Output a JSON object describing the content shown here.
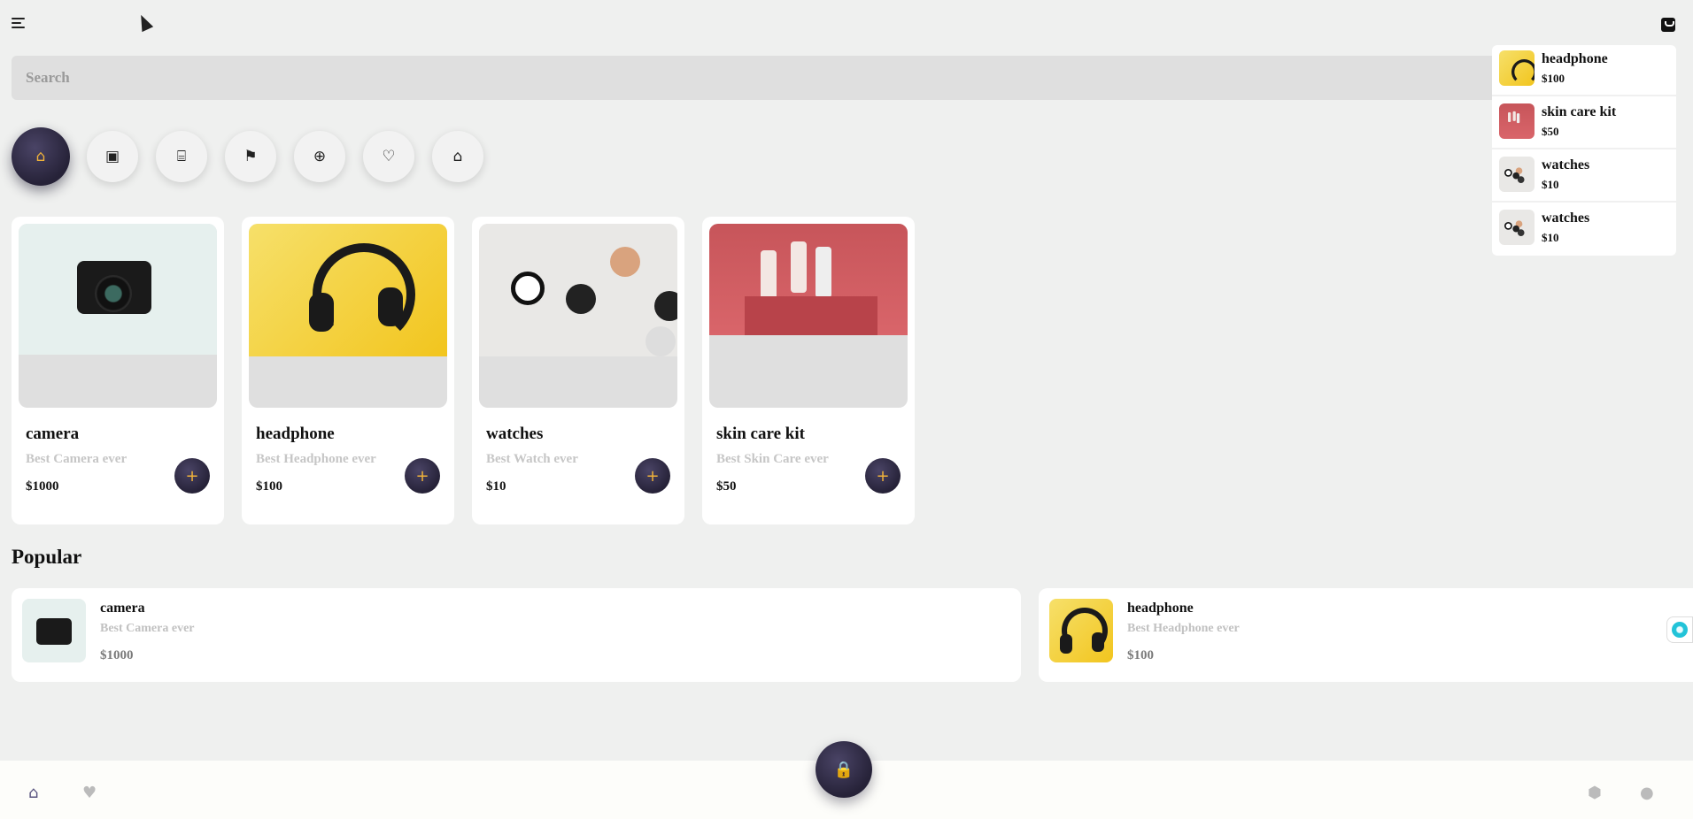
{
  "search": {
    "placeholder": "Search"
  },
  "categories": [
    {
      "icon": "home-icon",
      "glyph": "⌂",
      "active": true
    },
    {
      "icon": "wallet-icon",
      "glyph": "▣"
    },
    {
      "icon": "store-icon",
      "glyph": "⌸"
    },
    {
      "icon": "bookmark-icon",
      "glyph": "⚑"
    },
    {
      "icon": "globe-icon",
      "glyph": "⊕"
    },
    {
      "icon": "heart-icon",
      "glyph": "♡"
    },
    {
      "icon": "house-filled-icon",
      "glyph": "⌂"
    }
  ],
  "products": [
    {
      "name": "camera",
      "desc": "Best Camera ever",
      "price": "$1000",
      "add": "+"
    },
    {
      "name": "headphone",
      "desc": "Best Headphone ever",
      "price": "$100",
      "add": "+"
    },
    {
      "name": "watches",
      "desc": "Best Watch ever",
      "price": "$10",
      "add": "+"
    },
    {
      "name": "skin care kit",
      "desc": "Best Skin Care ever",
      "price": "$50",
      "add": "+"
    }
  ],
  "popular": {
    "title": "Popular",
    "items": [
      {
        "name": "camera",
        "desc": "Best Camera ever",
        "price": "$1000"
      },
      {
        "name": "headphone",
        "desc": "Best Headphone ever",
        "price": "$100"
      }
    ]
  },
  "cart": {
    "items": [
      {
        "name": "headphone",
        "price": "$100"
      },
      {
        "name": "skin care kit",
        "price": "$50"
      },
      {
        "name": "watches",
        "price": "$10"
      },
      {
        "name": "watches",
        "price": "$10"
      }
    ]
  },
  "bottom_nav": {
    "home_glyph": "⌂",
    "fav_glyph": "♥",
    "settings_glyph": "⬢",
    "user_glyph": "●",
    "bag_glyph": "🔒"
  },
  "colors": {
    "accent": "#f0b23a",
    "dark": "#262238",
    "background": "#eff0ef"
  }
}
